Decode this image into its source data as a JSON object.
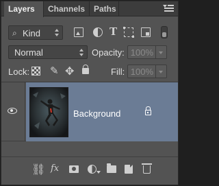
{
  "tabs": [
    {
      "label": "Layers",
      "active": true
    },
    {
      "label": "Channels",
      "active": false
    },
    {
      "label": "Paths",
      "active": false
    }
  ],
  "filter": {
    "kind_label": "Kind",
    "icons": [
      "pixel-layer-filter-icon",
      "adjustment-layer-filter-icon",
      "type-layer-filter-icon",
      "shape-layer-filter-icon",
      "smart-object-filter-icon"
    ]
  },
  "blend_mode": "Normal",
  "opacity": {
    "label": "Opacity:",
    "value": "100%"
  },
  "lock": {
    "label": "Lock:",
    "icons": [
      "lock-transparent-pixels-icon",
      "lock-image-pixels-icon",
      "lock-position-icon",
      "lock-all-icon"
    ]
  },
  "fill": {
    "label": "Fill:",
    "value": "100%"
  },
  "layers": [
    {
      "name": "Background",
      "visible": true,
      "selected": true,
      "locked": true
    }
  ],
  "footer_icons": [
    "link-layers-icon",
    "fx-icon",
    "add-mask-icon",
    "adjustment-layer-icon",
    "new-group-icon",
    "new-layer-icon",
    "trash-icon"
  ],
  "colors": {
    "panel_bg": "#535353",
    "tab_bar_bg": "#3c3c3c",
    "selected_layer_bg": "#6b7c95",
    "text": "#e0e0e0"
  }
}
